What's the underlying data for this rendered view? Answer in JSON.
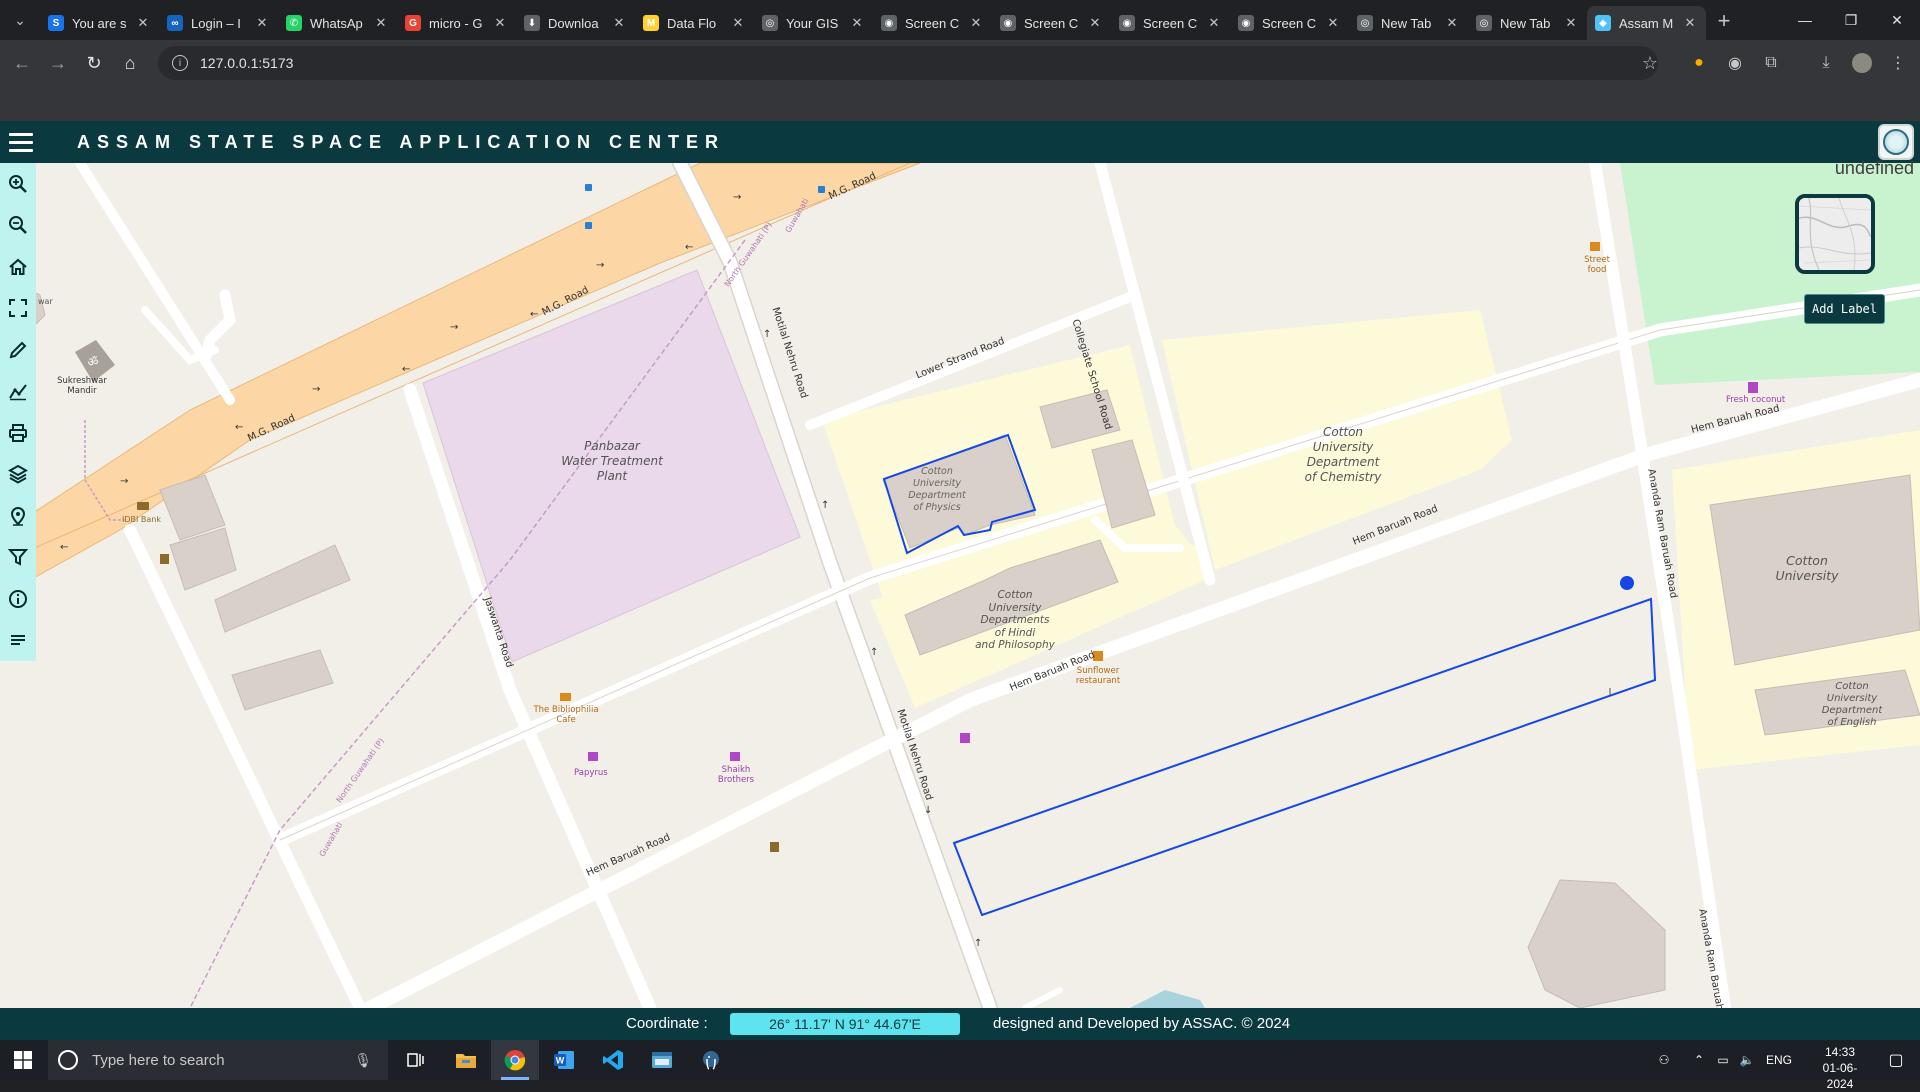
{
  "browser": {
    "tabs": [
      {
        "title": "You are s",
        "favicon": "s-icon",
        "color": "#1a73e8",
        "glyph": "S"
      },
      {
        "title": "Login – I",
        "favicon": "infinity-icon",
        "color": "#1565c0",
        "glyph": "∞"
      },
      {
        "title": "WhatsAp",
        "favicon": "whatsapp-icon",
        "color": "#25d366",
        "glyph": "✆"
      },
      {
        "title": "micro - G",
        "favicon": "google-icon",
        "color": "#ea4335",
        "glyph": "G"
      },
      {
        "title": "Downloa",
        "favicon": "download-icon",
        "color": "#5f6368",
        "glyph": "⬇"
      },
      {
        "title": "Data Flo",
        "favicon": "miro-icon",
        "color": "#ffd02f",
        "glyph": "M"
      },
      {
        "title": "Your GIS",
        "favicon": "globe-icon",
        "color": "#5f6368",
        "glyph": "◎"
      },
      {
        "title": "Screen C",
        "favicon": "camera-icon",
        "color": "#5f6368",
        "glyph": "◉"
      },
      {
        "title": "Screen C",
        "favicon": "camera-icon",
        "color": "#5f6368",
        "glyph": "◉"
      },
      {
        "title": "Screen C",
        "favicon": "camera-icon",
        "color": "#5f6368",
        "glyph": "◉"
      },
      {
        "title": "Screen C",
        "favicon": "camera-icon",
        "color": "#5f6368",
        "glyph": "◉"
      },
      {
        "title": "New Tab",
        "favicon": "globe-icon",
        "color": "#5f6368",
        "glyph": "◎"
      },
      {
        "title": "New Tab",
        "favicon": "globe-icon",
        "color": "#5f6368",
        "glyph": "◎"
      },
      {
        "title": "Assam M",
        "favicon": "layers-icon",
        "color": "#4fc3f7",
        "glyph": "◆",
        "active": true
      }
    ],
    "url": "127.0.0.1:5173"
  },
  "app": {
    "title": "ASSAM STATE SPACE APPLICATION CENTER",
    "basemap_caption": "undefined",
    "add_label_button": "Add Label",
    "tools": [
      "zoom-in-icon",
      "zoom-out-icon",
      "home-icon",
      "fullscreen-icon",
      "draw-pencil-icon",
      "measure-icon",
      "print-icon",
      "layers-icon",
      "location-pin-icon",
      "filter-icon",
      "info-icon",
      "legend-icon"
    ]
  },
  "map": {
    "labels": {
      "mg_road": "M.G. Road",
      "mg_road_2": "M.G. Road",
      "mg_road_3": "M.G. Road",
      "water_plant": [
        "Panbazar",
        "Water Treatment",
        "Plant"
      ],
      "physics": [
        "Cotton",
        "University",
        "Department",
        "of Physics"
      ],
      "chemistry": [
        "Cotton",
        "University",
        "Department",
        "of Chemistry"
      ],
      "hindi": [
        "Cotton",
        "University",
        "Departments",
        "of Hindi",
        "and Philosophy"
      ],
      "cotton_univ": [
        "Cotton",
        "University"
      ],
      "english": [
        "Cotton",
        "University",
        "Department",
        "of English"
      ],
      "lower_strand": "Lower Strand Road",
      "collegiate": "Collegiate School Road",
      "motilal": "Motilal Nehru Road",
      "motilal_2": "Motilal Nehru Road",
      "jaswanta": "Jaswanta Road",
      "hem_baruah_1": "Hem Baruah Road",
      "hem_baruah_2": "Hem Baruah Road",
      "hem_baruah_3": "Hem Baruah Road",
      "hem_baruah_4": "Hem Baruah Road",
      "ananda_1": "Ananda Ram Baruah Road",
      "ananda_2": "Ananda Ram Baruah",
      "sukreshwar": [
        "Sukreshwar",
        "Mandir"
      ],
      "idbi": "IDBI Bank",
      "bibliophilia": [
        "The Bibliophilia",
        "Cafe"
      ],
      "papyrus": "Papyrus",
      "shaikh": [
        "Shaikh",
        "Brothers"
      ],
      "sunflower": [
        "Sunflower",
        "restaurant"
      ],
      "street_food": [
        "Street",
        "food"
      ],
      "fresh_coconut": "Fresh coconut",
      "north_guwahati_1": "North Guwahati (P)",
      "north_guwahati_2": "North Guwahati (P)",
      "guwahati_1": "Guwahati",
      "guwahati_2": "Guwahati",
      "war_fragment": "war"
    }
  },
  "status": {
    "coordinate_label": "Coordinate :",
    "coordinate_value": "26° 11.17' N 91° 44.67'E",
    "credit": "designed and Developed by ASSAC. © 2024"
  },
  "taskbar": {
    "search_placeholder": "Type here to search",
    "language": "ENG",
    "time": "14:33",
    "date": "01-06-2024"
  }
}
